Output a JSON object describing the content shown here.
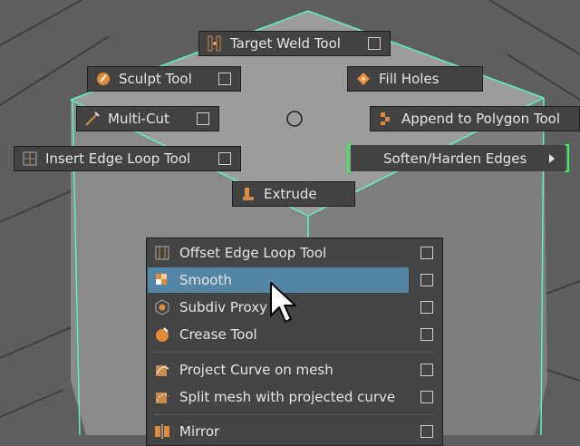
{
  "marking_menu": {
    "center_icon": "circle-center-icon",
    "items": [
      {
        "id": "target-weld-tool",
        "label": "Target Weld Tool",
        "icon": "target-weld-icon"
      },
      {
        "id": "sculpt-tool",
        "label": "Sculpt Tool",
        "icon": "sculpt-icon"
      },
      {
        "id": "fill-holes",
        "label": "Fill Holes",
        "icon": "fill-holes-icon"
      },
      {
        "id": "multi-cut",
        "label": "Multi-Cut",
        "icon": "multi-cut-icon"
      },
      {
        "id": "append-polygon",
        "label": "Append to Polygon Tool",
        "icon": "append-polygon-icon"
      },
      {
        "id": "insert-edge-loop",
        "label": "Insert Edge Loop Tool",
        "icon": "insert-edge-loop-icon"
      },
      {
        "id": "soften-harden",
        "label": "Soften/Harden Edges",
        "icon": "submenu-arrow-icon",
        "highlight_color": "#29ff5a"
      },
      {
        "id": "extrude",
        "label": "Extrude",
        "icon": "extrude-icon"
      }
    ]
  },
  "context_menu": {
    "items": [
      {
        "label": "Offset Edge Loop Tool",
        "icon": "offset-edge-loop-icon"
      },
      {
        "label": "Smooth",
        "icon": "smooth-icon",
        "selected": true
      },
      {
        "label": "Subdiv Proxy",
        "icon": "subdiv-proxy-icon"
      },
      {
        "label": "Crease Tool",
        "icon": "crease-icon"
      },
      {
        "label": "Project Curve on mesh",
        "icon": "project-curve-icon"
      },
      {
        "label": "Split mesh with projected curve",
        "icon": "split-mesh-icon"
      },
      {
        "label": "Mirror",
        "icon": "mirror-icon"
      }
    ],
    "selection_color": "#5285a6"
  },
  "viewport": {
    "background": "#5e5e5e",
    "mesh_face_color": "#9a9a9a",
    "mesh_highlight_color": "#5cf0c0"
  }
}
